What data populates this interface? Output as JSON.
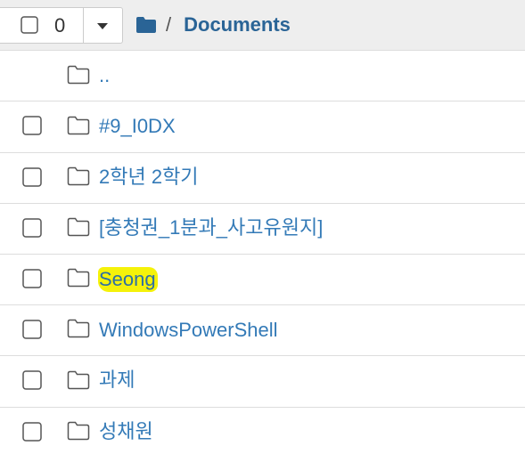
{
  "toolbar": {
    "selected_count": "0",
    "breadcrumb_separator": "/",
    "breadcrumb_current": "Documents"
  },
  "rows": [
    {
      "name": "..",
      "has_checkbox": false,
      "highlight": false
    },
    {
      "name": "#9_I0DX",
      "has_checkbox": true,
      "highlight": false
    },
    {
      "name": "2학년 2학기",
      "has_checkbox": true,
      "highlight": false
    },
    {
      "name": "[충청권_1분과_사고유원지]",
      "has_checkbox": true,
      "highlight": false
    },
    {
      "name": "Seong",
      "has_checkbox": true,
      "highlight": true
    },
    {
      "name": "WindowsPowerShell",
      "has_checkbox": true,
      "highlight": false
    },
    {
      "name": "과제",
      "has_checkbox": true,
      "highlight": false
    },
    {
      "name": "성채원",
      "has_checkbox": true,
      "highlight": false
    }
  ],
  "colors": {
    "link": "#337ab7",
    "breadcrumb": "#2a6496",
    "highlight": "#f5f20a",
    "toolbar_bg": "#eeeeee"
  },
  "icons": {
    "breadcrumb_root": "folder-filled-icon",
    "row_folder": "folder-outline-icon",
    "dropdown": "caret-down-icon"
  }
}
